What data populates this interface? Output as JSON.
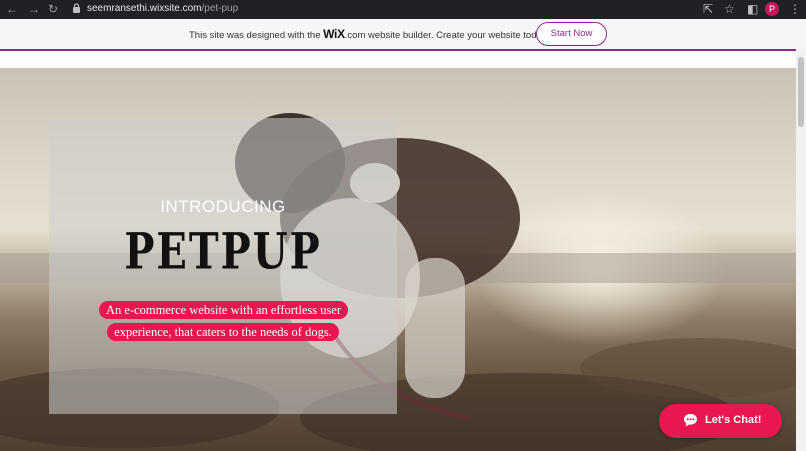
{
  "browser": {
    "url_host": "seemransethi.wixsite.com",
    "url_path": "/pet-pup",
    "avatar_letter": "P"
  },
  "wix_banner": {
    "text_before": "This site was designed with the ",
    "logo": "WiX",
    "text_after": ".com website builder. Create your website today.",
    "start_button": "Start Now"
  },
  "hero": {
    "intro": "INTRODUCING",
    "brand": "PETPUP",
    "tagline": "An e-commerce website with an effortless user experience, that caters to the needs of dogs."
  },
  "chat": {
    "label": "Let's Chat!"
  },
  "colors": {
    "accent": "#e8174f",
    "wix_purple": "#8a2b8e",
    "chrome_dark": "#202124"
  }
}
